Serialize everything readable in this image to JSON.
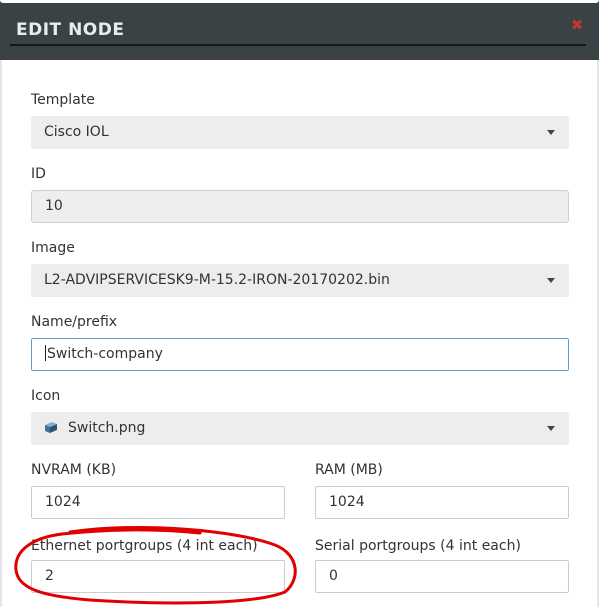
{
  "dialog": {
    "title": "EDIT NODE",
    "close_glyph": "✖"
  },
  "form": {
    "template": {
      "label": "Template",
      "value": "Cisco IOL"
    },
    "id": {
      "label": "ID",
      "value": "10"
    },
    "image": {
      "label": "Image",
      "value": "L2-ADVIPSERVICESK9-M-15.2-IRON-20170202.bin"
    },
    "name": {
      "label": "Name/prefix",
      "value": "Switch-company"
    },
    "icon": {
      "label": "Icon",
      "value": "Switch.png",
      "icon_name": "switch-icon"
    },
    "nvram": {
      "label": "NVRAM (KB)",
      "value": "1024"
    },
    "ram": {
      "label": "RAM (MB)",
      "value": "1024"
    },
    "ethernet": {
      "label": "Ethernet portgroups (4 int each)",
      "value": "2"
    },
    "serial": {
      "label": "Serial portgroups (4 int each)",
      "value": "0"
    }
  },
  "colors": {
    "header_bg": "#3b4245",
    "close": "#c0392b",
    "annotation": "#e00000",
    "focus_border": "#5a9dd6"
  }
}
